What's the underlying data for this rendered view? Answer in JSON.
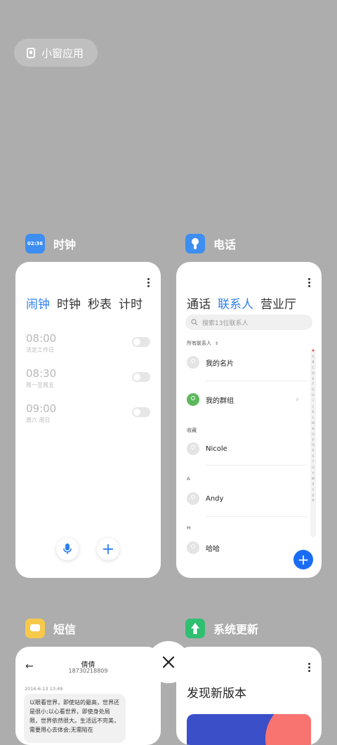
{
  "small_window": {
    "label": "小窗应用",
    "icon": "small-window-icon"
  },
  "clock": {
    "app_name": "时钟",
    "icon_text": "02:36",
    "tabs": [
      "闹钟",
      "时钟",
      "秒表",
      "计时"
    ],
    "alarms": [
      {
        "time": "08:00",
        "days": "法定工作日"
      },
      {
        "time": "08:30",
        "days": "周一至周五"
      },
      {
        "time": "09:00",
        "days": "周六 周日"
      }
    ]
  },
  "phone": {
    "app_name": "电话",
    "tabs": [
      "通话",
      "联系人",
      "营业厅"
    ],
    "search_placeholder": "搜索13位联系人",
    "all_contacts": "所有联系人",
    "my_card": "我的名片",
    "my_groups": "我的群组",
    "favorites_header": "收藏",
    "favorite_contact": "Nicole",
    "section_a": "A",
    "contact_a": "Andy",
    "section_h": "H",
    "contact_h": "哈哈",
    "index": [
      "♥",
      "A",
      "B",
      "C",
      "D",
      "E",
      "F",
      "G",
      "H",
      "I",
      "J",
      "K",
      "L",
      "M",
      "N",
      "O",
      "P",
      "Q",
      "R",
      "S",
      "T",
      "U",
      "V",
      "W",
      "X",
      "Y",
      "Z",
      "#"
    ]
  },
  "sms": {
    "app_name": "短信",
    "contact_name": "倩倩",
    "contact_number": "18730218809",
    "timestamp": "2016-6-13 13:49",
    "message": "以眼看世界，即使站的最高，世界还是很小;以心看世界，即使身处局限，世界依然很大。生活远不完美，需要用心去体会;无需陷在"
  },
  "update": {
    "app_name": "系统更新",
    "title": "发现新版本"
  },
  "colors": {
    "accent": "#2f80ed",
    "fab": "#1a6cf5",
    "background": "#adadad"
  }
}
